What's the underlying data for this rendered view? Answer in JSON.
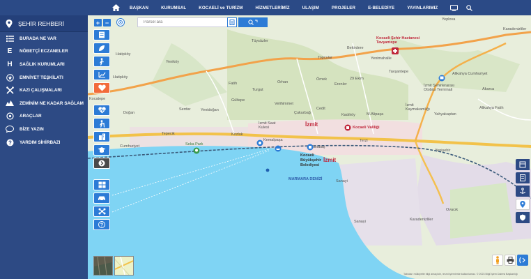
{
  "nav": {
    "items": [
      "BAŞKAN",
      "KURUMSAL",
      "KOCAELİ ve TURİZM",
      "HİZMETLERİMİZ",
      "ULAŞIM",
      "PROJELER",
      "E-BELEDİYE",
      "YAYINLARIMIZ"
    ]
  },
  "sidebar": {
    "title": "ŞEHİR REHBERİ",
    "items": [
      {
        "label": "BURADA NE VAR",
        "icon": "list-icon"
      },
      {
        "label": "NÖBETÇİ ECZANELER",
        "icon": "pharmacy-icon"
      },
      {
        "label": "SAĞLIK KURUMLARI",
        "icon": "hospital-icon"
      },
      {
        "label": "EMNİYET TEŞKİLATI",
        "icon": "police-icon"
      },
      {
        "label": "KAZI ÇALIŞMALARI",
        "icon": "tools-icon"
      },
      {
        "label": "ZEMİNİM NE KADAR SAĞLAM",
        "icon": "ground-icon"
      },
      {
        "label": "ARAÇLAR",
        "icon": "car-icon"
      },
      {
        "label": "BİZE YAZIN",
        "icon": "chat-icon"
      },
      {
        "label": "YARDIM SİHİRBAZI",
        "icon": "help-icon"
      }
    ]
  },
  "search": {
    "placeholder": "Parsel ara"
  },
  "map": {
    "labels": {
      "izmit1": "İzmit",
      "izmit2": "İzmit",
      "marmara": "MARMARA DENİZİ",
      "hospital": "Kocaeli Şehir Hastanesi Tavşantepe",
      "valilik": "Kocaeli Valiliği",
      "belediye": "Kocaeli Büyükşehir Belediyesi",
      "seka": "Seka Park",
      "otogar": "İzmit Şehirlerarası Otobüs Terminali",
      "kaymakam": "İzmit Kaymakamlığı",
      "saat": "İzmit Saat Kulesi",
      "yeplova": "Yeplova",
      "karadenizliler": "Karadenizliler",
      "bekirdere": "Bekirdere",
      "topcular": "Topçular",
      "tuysuzler": "Tüysüzler",
      "tavsantepe": "Tavşantepe",
      "alikahya_c": "Alikahya Cumhuriyet",
      "akarca": "Akarca",
      "yahyakaptan": "Yahyakaptan",
      "alikahya_f": "Alikahya Fatih",
      "erenler": "Erenler",
      "m29": "29 Ekim",
      "yenimahalle": "Yenimahalle",
      "ornek": "Örnek",
      "fatih": "Fatih",
      "turgut": "Turgut",
      "orhan": "Orhan",
      "gultepe": "Gültepe",
      "serdar": "Serdar",
      "yenidogan": "Yenidoğan",
      "velihimmet": "Velihimmet",
      "cukurbag": "Çukurbağ",
      "cedit": "Cedit",
      "kadikoy": "Kadıköy",
      "malipasa": "M.Alipaşa",
      "hatipkoy": "Hatipköy",
      "hatipkoy2": "Hatipköy",
      "yenikoy": "Yeniköy",
      "kocatepe": "Kocatepe",
      "dogan": "Doğan",
      "kozluk": "Kozluk",
      "cumhuriyet": "Cumhuriyet",
      "tepecik": "Tepecik",
      "kemalpasa": "Kemalpaşa",
      "karabas": "Karabaş",
      "terzi": "Terzi",
      "sanayi": "Sanayi",
      "sanayi2": "Sanayi",
      "ovacik": "Ovacık",
      "karadenizliler2": "Karadenizliler",
      "yenisehir": "Yenişehir"
    },
    "attribution": "Tabloları mülkiyette bilgi amaçlıdır, resmi işlemlerde kullanılamaz. © 2023 Bilgi İşlem Dairesi Başkanlığı"
  }
}
